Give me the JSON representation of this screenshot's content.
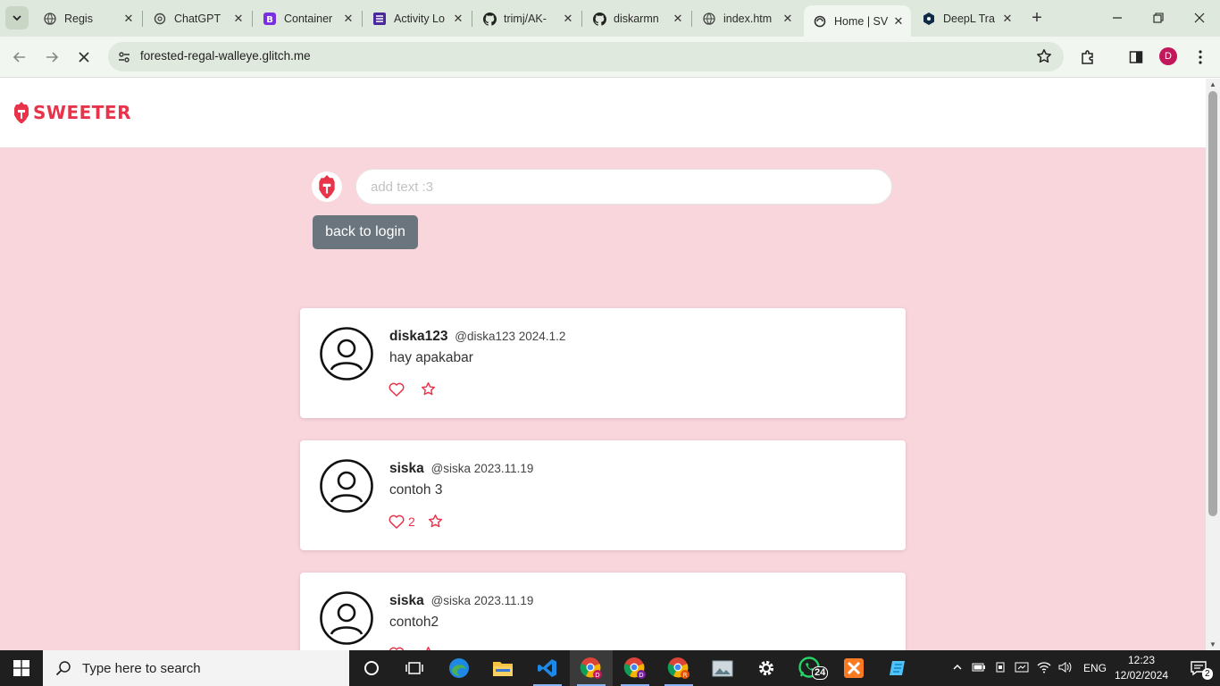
{
  "browser": {
    "tabs": [
      {
        "title": "Regis",
        "icon": "globe-icon"
      },
      {
        "title": "ChatGPT",
        "icon": "chatgpt-icon"
      },
      {
        "title": "Container",
        "icon": "bootstrap-icon"
      },
      {
        "title": "Activity Lo",
        "icon": "activity-icon"
      },
      {
        "title": "trimj/AK-",
        "icon": "github-icon"
      },
      {
        "title": "diskarmn",
        "icon": "github-icon"
      },
      {
        "title": "index.htm",
        "icon": "globe-icon"
      },
      {
        "title": "Home | SV",
        "icon": "glitch-icon"
      },
      {
        "title": "DeepL Tra",
        "icon": "deepl-icon"
      }
    ],
    "active_tab": 7,
    "url": "forested-regal-walleye.glitch.me",
    "profile_initial": "D"
  },
  "site": {
    "brand": "SWEETER",
    "composer_placeholder": "add text :3",
    "back_button": "back to login",
    "accent_color": "#e8334a",
    "background_color": "#f9d5dc"
  },
  "posts": [
    {
      "name": "diska123",
      "handle": "@diska123",
      "date": "2024.1.2",
      "text": "hay apakabar",
      "likes": ""
    },
    {
      "name": "siska",
      "handle": "@siska",
      "date": "2023.11.19",
      "text": "contoh 3",
      "likes": "2"
    },
    {
      "name": "siska",
      "handle": "@siska",
      "date": "2023.11.19",
      "text": "contoh2",
      "likes": ""
    }
  ],
  "taskbar": {
    "search_placeholder": "Type here to search",
    "whatsapp_badge": "24",
    "language": "ENG",
    "time": "12:23",
    "date": "12/02/2024",
    "notifications": "2"
  }
}
